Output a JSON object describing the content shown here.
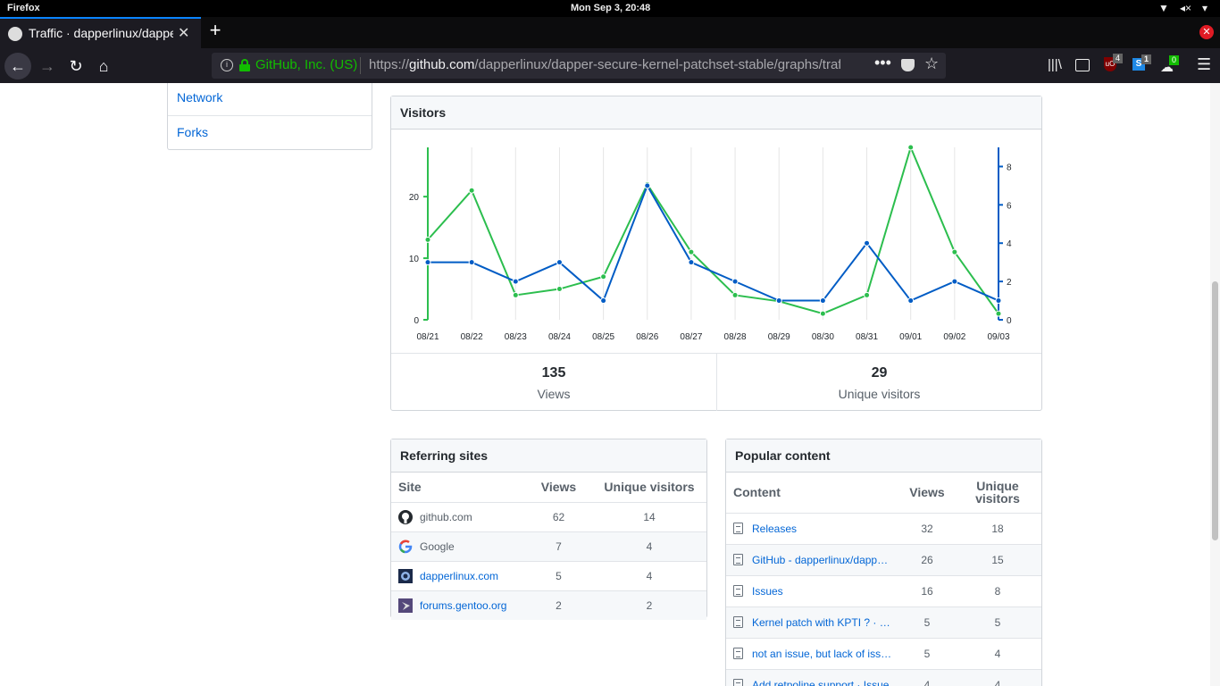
{
  "system": {
    "app_name": "Firefox",
    "clock": "Mon Sep  3, 20:48"
  },
  "browser": {
    "tab_title": "Traffic · dapperlinux/dapper-secure-kernel-patchset-stable",
    "identity": "GitHub, Inc. (US)",
    "url_prefix": "https://",
    "url_host": "github.com",
    "url_path": "/dapperlinux/dapper-secure-kernel-patchset-stable/graphs/traffic",
    "badges": {
      "ublock": "4",
      "stylus": "1",
      "ext3": "0"
    }
  },
  "sidebar": {
    "items": [
      {
        "label": "Network"
      },
      {
        "label": "Forks"
      }
    ]
  },
  "visitors": {
    "title": "Visitors",
    "views_total": "135",
    "views_label": "Views",
    "unique_total": "29",
    "unique_label": "Unique visitors"
  },
  "chart_data": {
    "type": "line",
    "x": [
      "08/21",
      "08/22",
      "08/23",
      "08/24",
      "08/25",
      "08/26",
      "08/27",
      "08/28",
      "08/29",
      "08/30",
      "08/31",
      "09/01",
      "09/02",
      "09/03"
    ],
    "series": [
      {
        "axis": "left",
        "color": "#2cbe4e",
        "values": [
          13,
          21,
          4,
          5,
          7,
          22,
          11,
          4,
          3,
          1,
          4,
          28,
          11,
          1
        ]
      },
      {
        "axis": "right",
        "color": "#005cc5",
        "values": [
          3,
          3,
          2,
          3,
          1,
          7,
          3,
          2,
          1,
          1,
          4,
          1,
          2,
          1
        ]
      }
    ],
    "left_axis": {
      "ylim": [
        0,
        28
      ],
      "ticks": [
        0,
        10,
        20
      ]
    },
    "right_axis": {
      "ylim": [
        0,
        9
      ],
      "ticks": [
        0,
        2,
        4,
        6,
        8
      ]
    },
    "grid": "vertical"
  },
  "referring": {
    "title": "Referring sites",
    "headers": {
      "site": "Site",
      "views": "Views",
      "unique": "Unique visitors"
    },
    "rows": [
      {
        "site": "github.com",
        "views": "62",
        "unique": "14",
        "icon": "github-icon",
        "link": false
      },
      {
        "site": "Google",
        "views": "7",
        "unique": "4",
        "icon": "google-icon",
        "link": false
      },
      {
        "site": "dapperlinux.com",
        "views": "5",
        "unique": "4",
        "icon": "dapperlinux-icon",
        "link": true
      },
      {
        "site": "forums.gentoo.org",
        "views": "2",
        "unique": "2",
        "icon": "gentoo-icon",
        "link": true
      }
    ]
  },
  "popular": {
    "title": "Popular content",
    "headers": {
      "content": "Content",
      "views": "Views",
      "unique": "Unique visitors"
    },
    "rows": [
      {
        "content": "Releases",
        "views": "32",
        "unique": "18"
      },
      {
        "content": "GitHub - dapperlinux/dapper-secure-kernel-patchset-stable",
        "views": "26",
        "unique": "15"
      },
      {
        "content": "Issues",
        "views": "16",
        "unique": "8"
      },
      {
        "content": "Kernel patch with KPTI ? · Issue",
        "views": "5",
        "unique": "5"
      },
      {
        "content": "not an issue, but lack of issues",
        "views": "5",
        "unique": "4"
      },
      {
        "content": "Add retpoline support · Issue",
        "views": "4",
        "unique": "4"
      }
    ]
  }
}
